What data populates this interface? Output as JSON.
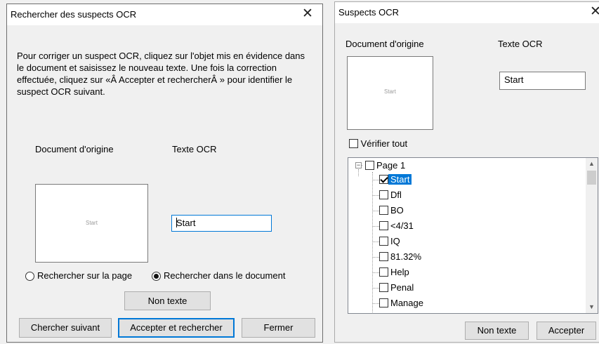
{
  "dialog1": {
    "title": "Rechercher des suspects OCR",
    "instructions": "Pour corriger un suspect OCR, cliquez sur l'objet mis en évidence dans le document et saisissez le nouveau texte. Une fois la correction effectuée, cliquez sur «Â Accepter et rechercherÂ » pour identifier le suspect OCR suivant.",
    "original_doc_label": "Document d'origine",
    "ocr_text_label": "Texte OCR",
    "preview_text": "Start",
    "ocr_value": "Start",
    "radio_page": "Rechercher sur la page",
    "radio_document": "Rechercher dans le document",
    "non_text_button": "Non texte",
    "find_next_button": "Chercher suivant",
    "accept_find_button": "Accepter et rechercher",
    "close_button": "Fermer"
  },
  "dialog2": {
    "title": "Suspects OCR",
    "original_doc_label": "Document d'origine",
    "ocr_text_label": "Texte OCR",
    "preview_text": "Start",
    "ocr_value": "Start",
    "verify_all": "Vérifier tout",
    "tree": {
      "page": "Page 1",
      "items": [
        "Start",
        "Dfl",
        "BO",
        "<4/31",
        "IQ",
        "81.32%",
        "Help",
        "Penal",
        "Manage"
      ]
    },
    "non_text_button": "Non texte",
    "accept_button": "Accepter"
  },
  "icons": {
    "close": "close-icon",
    "scroll_up": "scroll-up-icon",
    "scroll_down": "scroll-down-icon",
    "collapse": "collapse-icon"
  },
  "colors": {
    "selection": "#0078d7",
    "window_bg": "#f0f0f0"
  }
}
